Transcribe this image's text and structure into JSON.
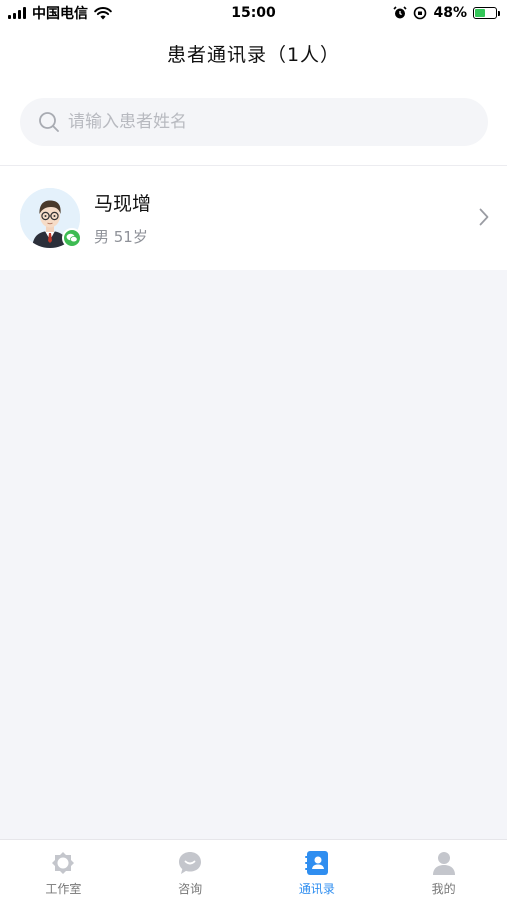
{
  "status_bar": {
    "carrier": "中国电信",
    "time": "15:00",
    "battery": "48%",
    "battery_level": 0.48
  },
  "header": {
    "title": "患者通讯录（1人）"
  },
  "search": {
    "placeholder": "请输入患者姓名",
    "value": ""
  },
  "patients": [
    {
      "name": "马现增",
      "meta": "男 51岁",
      "channel_icon": "wechat-icon"
    }
  ],
  "tabs": [
    {
      "label": "工作室",
      "icon": "studio-icon",
      "active": false
    },
    {
      "label": "咨询",
      "icon": "chat-bubble-icon",
      "active": false
    },
    {
      "label": "通讯录",
      "icon": "contacts-icon",
      "active": true
    },
    {
      "label": "我的",
      "icon": "person-icon",
      "active": false
    }
  ],
  "colors": {
    "accent": "#2f8ef0",
    "wechat": "#3dbb52",
    "page_bg": "#f4f5f9"
  }
}
